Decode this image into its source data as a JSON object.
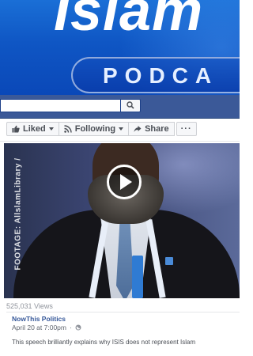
{
  "banner": {
    "title": "Islam",
    "subtitle": "PODCA"
  },
  "search": {
    "value": "",
    "placeholder": ""
  },
  "actions": {
    "liked_label": "Liked",
    "following_label": "Following",
    "share_label": "Share",
    "more_label": "···"
  },
  "video": {
    "watermark": "FOOTAGE: AllslamLibrary /",
    "views": "525,031 Views"
  },
  "post": {
    "page_name": "NowThis Politics",
    "date": "April 20 at 7:00pm",
    "separator": "·",
    "caption": "This speech brilliantly explains why ISIS does not represent Islam"
  },
  "colors": {
    "facebook_blue": "#3b5998",
    "link_blue": "#365899",
    "banner_blue": "#0f56c4"
  }
}
